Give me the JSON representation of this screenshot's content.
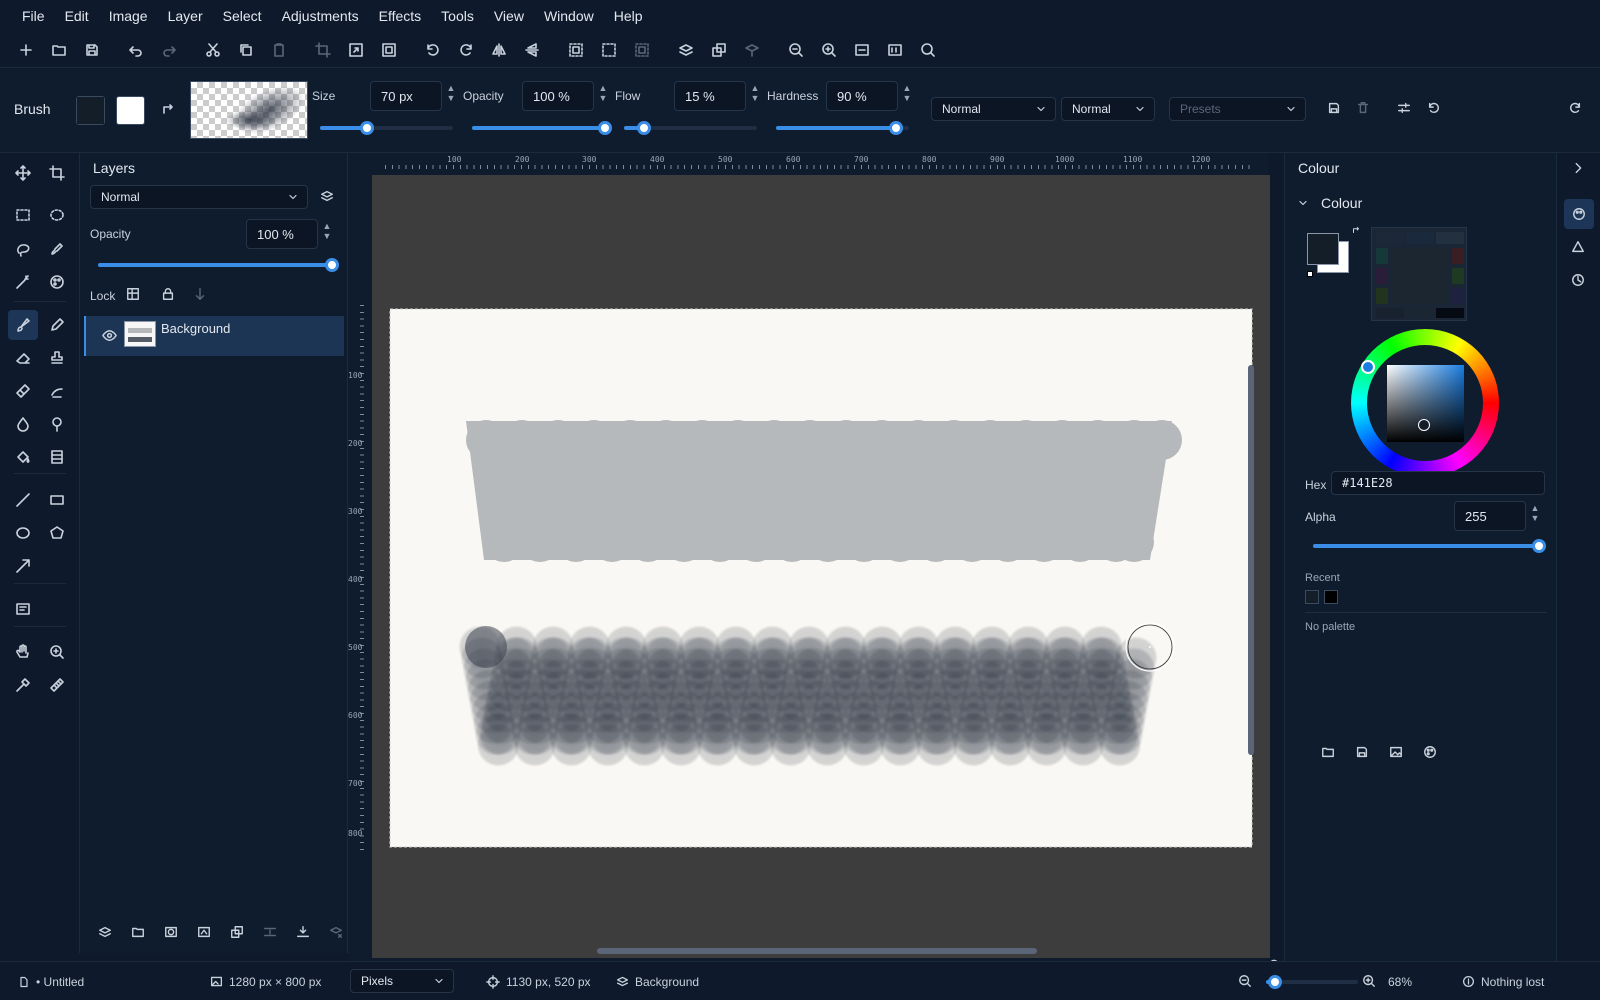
{
  "menu": [
    "File",
    "Edit",
    "Image",
    "Layer",
    "Select",
    "Adjustments",
    "Effects",
    "Tools",
    "View",
    "Window",
    "Help"
  ],
  "brush_bar": {
    "tool_label": "Brush",
    "size_label": "Size",
    "size_value": "70 px",
    "size_level": 0.35,
    "opacity_label": "Opacity",
    "opacity_value": "100 %",
    "opacity_level": 1.0,
    "flow_label": "Flow",
    "flow_value": "15 %",
    "flow_level": 0.15,
    "hardness_label": "Hardness",
    "hardness_value": "90 %",
    "hardness_level": 0.9,
    "blend_mode_1": "Normal",
    "blend_mode_2": "Normal",
    "presets_placeholder": "Presets"
  },
  "layers_panel": {
    "title": "Layers",
    "blend_mode": "Normal",
    "opacity_label": "Opacity",
    "opacity_value": "100 %",
    "opacity_level": 1.0,
    "lock_label": "Lock",
    "layers": [
      {
        "name": "Background",
        "visible": true
      }
    ]
  },
  "rulers": {
    "horizontal": [
      "100",
      "200",
      "300",
      "400",
      "500",
      "600",
      "700",
      "800",
      "900",
      "1000",
      "1100",
      "1200"
    ],
    "vertical": [
      "100",
      "200",
      "300",
      "400",
      "500",
      "600",
      "700",
      "800"
    ]
  },
  "colour_panel": {
    "title": "Colour",
    "section": "Colour",
    "hex_label": "Hex",
    "hex_value": "#141E28",
    "alpha_label": "Alpha",
    "alpha_value": "255",
    "alpha_level": 1.0,
    "recent_label": "Recent",
    "recent_colors": [
      "#141e28",
      "#000000"
    ],
    "palette_text": "No palette",
    "primary_color": "#141e28",
    "secondary_color": "#ffffff"
  },
  "status": {
    "document": "• Untitled",
    "image_size": "1280 px × 800 px",
    "units": "Pixels",
    "cursor_position": "1130 px, 520 px",
    "layer": "Background",
    "zoom": "68%",
    "zoom_level": 0.1,
    "history": "Nothing lost"
  },
  "colors": {
    "accent": "#3b8ee8",
    "panel_bg": "#0f1c2e",
    "canvas_bg": "#3d3d3d",
    "paper": "#faf8f4"
  }
}
